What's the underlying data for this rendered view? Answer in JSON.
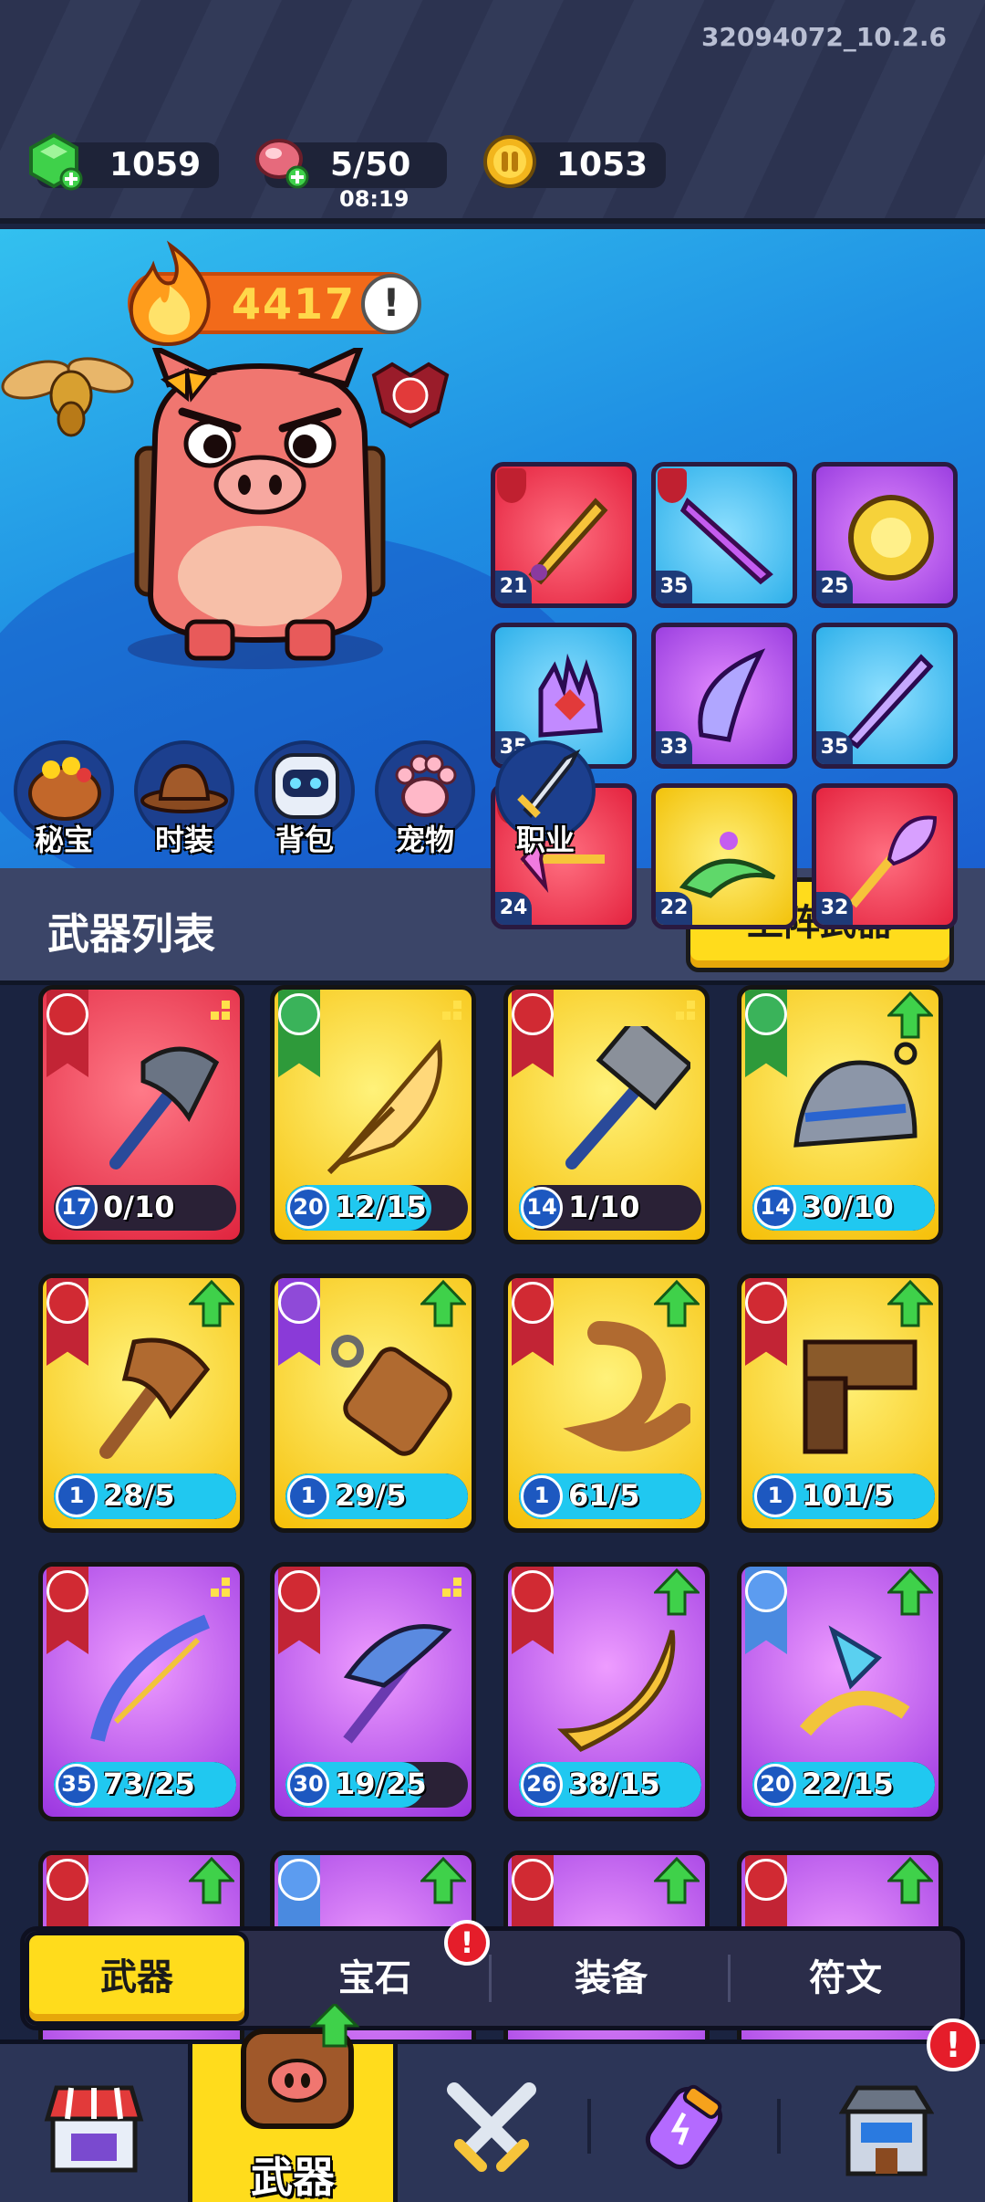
{
  "version_label": "32094072_10.2.6",
  "resources": {
    "gems": "1059",
    "stamina": "5/50",
    "stamina_timer": "08:19",
    "coins": "1053"
  },
  "hero": {
    "power": "4417",
    "power_info_glyph": "!",
    "equipped": [
      {
        "level": "21",
        "rarity": "red"
      },
      {
        "level": "35",
        "rarity": "blue"
      },
      {
        "level": "25",
        "rarity": "purple"
      },
      {
        "level": "35",
        "rarity": "blue"
      },
      {
        "level": "33",
        "rarity": "purple"
      },
      {
        "level": "35",
        "rarity": "blue"
      },
      {
        "level": "24",
        "rarity": "red"
      },
      {
        "level": "22",
        "rarity": "yellow"
      },
      {
        "level": "32",
        "rarity": "red"
      }
    ],
    "categories": [
      "秘宝",
      "时装",
      "背包",
      "宠物",
      "职业"
    ]
  },
  "weapons_list": {
    "title": "武器列表",
    "deploy_button": "上阵武器",
    "cards": [
      {
        "level": "17",
        "count": "0/10",
        "progress": 0.0,
        "rarity": "red"
      },
      {
        "level": "20",
        "count": "12/15",
        "progress": 0.8,
        "rarity": "yellow"
      },
      {
        "level": "14",
        "count": "1/10",
        "progress": 0.1,
        "rarity": "yellow"
      },
      {
        "level": "14",
        "count": "30/10",
        "progress": 1.0,
        "rarity": "yellow"
      },
      {
        "level": "1",
        "count": "28/5",
        "progress": 1.0,
        "rarity": "yellow"
      },
      {
        "level": "1",
        "count": "29/5",
        "progress": 1.0,
        "rarity": "yellow"
      },
      {
        "level": "1",
        "count": "61/5",
        "progress": 1.0,
        "rarity": "yellow"
      },
      {
        "level": "1",
        "count": "101/5",
        "progress": 1.0,
        "rarity": "yellow"
      },
      {
        "level": "35",
        "count": "73/25",
        "progress": 1.0,
        "rarity": "purple"
      },
      {
        "level": "30",
        "count": "19/25",
        "progress": 0.76,
        "rarity": "purple"
      },
      {
        "level": "26",
        "count": "38/15",
        "progress": 1.0,
        "rarity": "purple"
      },
      {
        "level": "20",
        "count": "22/15",
        "progress": 1.0,
        "rarity": "purple"
      }
    ]
  },
  "sub_tabs": [
    "武器",
    "宝石",
    "装备",
    "符文"
  ],
  "sub_tab_badge": "!",
  "bottom_nav": {
    "active_label": "武器",
    "alert_badge": "!"
  },
  "colors": {
    "accent_yellow": "#ffdc1c",
    "progress_cyan": "#20c8f0",
    "alert_red": "#e51d2a"
  }
}
